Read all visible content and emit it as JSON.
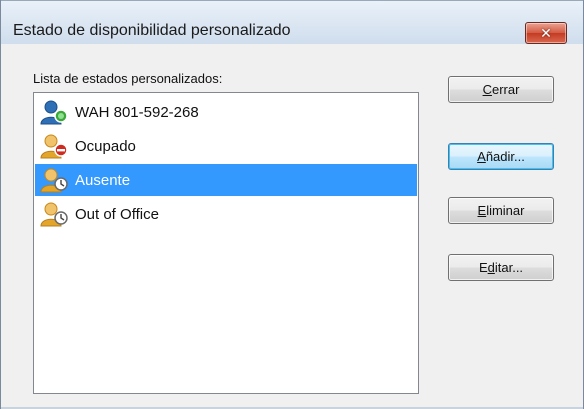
{
  "window": {
    "title": "Estado de disponibilidad personalizado",
    "close_glyph": "✕"
  },
  "list": {
    "label": "Lista de estados personalizados:",
    "items": [
      {
        "label": "WAH 801-592-268",
        "status_icon": "available-presence-icon",
        "person_color": "#2f6fb6",
        "status_color": "#3aa83a",
        "selected": false
      },
      {
        "label": "Ocupado",
        "status_icon": "busy-presence-icon",
        "person_color": "#e3a52a",
        "status_color": "#d22a1f",
        "selected": false
      },
      {
        "label": "Ausente",
        "status_icon": "away-presence-icon",
        "person_color": "#e3a52a",
        "status_color": "#8a8a8a",
        "selected": true
      },
      {
        "label": "Out of Office",
        "status_icon": "away-presence-icon",
        "person_color": "#e3a52a",
        "status_color": "#8a8a8a",
        "selected": false
      }
    ]
  },
  "buttons": {
    "close": {
      "prefix": "",
      "accel": "C",
      "suffix": "errar"
    },
    "add": {
      "prefix": "",
      "accel": "A",
      "suffix": "ñadir..."
    },
    "delete": {
      "prefix": "",
      "accel": "E",
      "suffix": "liminar"
    },
    "edit": {
      "prefix": "E",
      "accel": "d",
      "suffix": "itar..."
    }
  },
  "colors": {
    "selection": "#3399ff",
    "default_button_border": "#3c7fb1"
  }
}
